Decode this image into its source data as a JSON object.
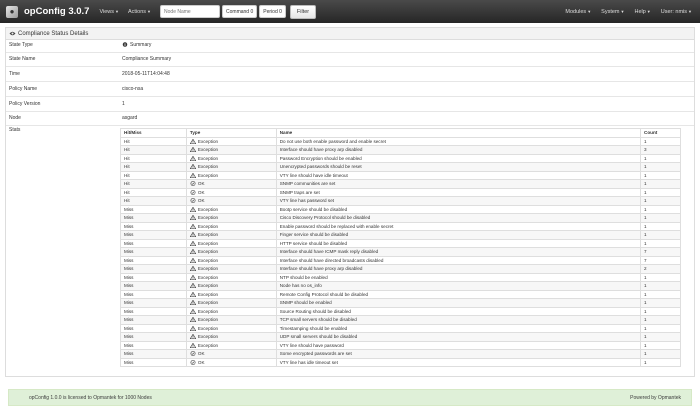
{
  "nav": {
    "brand": "opConfig 3.0.7",
    "menus_left": [
      "Views",
      "Actions"
    ],
    "node_placeholder": "Node Name",
    "command_label": "Command",
    "command_badge": "0",
    "period_label": "Period",
    "period_badge": "0",
    "filter_label": "Filter",
    "menus_right": [
      "Modules",
      "System",
      "Help",
      "User: nmis"
    ]
  },
  "panel": {
    "title": "Compliance Status Details",
    "fields": [
      {
        "key": "State Type",
        "value": "Summary"
      },
      {
        "key": "State Name",
        "value": "Compliance Summary"
      },
      {
        "key": "Time",
        "value": "2018-05-11T14:04:48"
      },
      {
        "key": "Policy Name",
        "value": "cisco-nsa"
      },
      {
        "key": "Policy Version",
        "value": "1"
      },
      {
        "key": "Node",
        "value": "asgard"
      },
      {
        "key": "Stats",
        "value": ""
      }
    ]
  },
  "stats": {
    "headers": [
      "Hit/Miss",
      "Type",
      "Name",
      "Count"
    ],
    "rows": [
      {
        "hit": "Hit",
        "type": "Exception",
        "name": "Do not use both enable password and enable secret",
        "count": "1"
      },
      {
        "hit": "Hit",
        "type": "Exception",
        "name": "Interface should have proxy arp disabled",
        "count": "3"
      },
      {
        "hit": "Hit",
        "type": "Exception",
        "name": "Password Encryption should be enabled",
        "count": "1"
      },
      {
        "hit": "Hit",
        "type": "Exception",
        "name": "Unencrypted passwords should be reset",
        "count": "1"
      },
      {
        "hit": "Hit",
        "type": "Exception",
        "name": "VTY line should have idle timeout",
        "count": "1"
      },
      {
        "hit": "Hit",
        "type": "OK",
        "name": "SNMP communities are set",
        "count": "1"
      },
      {
        "hit": "Hit",
        "type": "OK",
        "name": "SNMP traps are set",
        "count": "1"
      },
      {
        "hit": "Hit",
        "type": "OK",
        "name": "VTY line has password set",
        "count": "1"
      },
      {
        "hit": "Miss",
        "type": "Exception",
        "name": "Bootp service should be disabled",
        "count": "1"
      },
      {
        "hit": "Miss",
        "type": "Exception",
        "name": "Cisco Discovery Protocol should be disabled",
        "count": "1"
      },
      {
        "hit": "Miss",
        "type": "Exception",
        "name": "Enable password should be replaced with enable secret",
        "count": "1"
      },
      {
        "hit": "Miss",
        "type": "Exception",
        "name": "Finger service should be disabled",
        "count": "1"
      },
      {
        "hit": "Miss",
        "type": "Exception",
        "name": "HTTP service should be disabled",
        "count": "1"
      },
      {
        "hit": "Miss",
        "type": "Exception",
        "name": "Interface should have ICMP mask reply disabled",
        "count": "7"
      },
      {
        "hit": "Miss",
        "type": "Exception",
        "name": "Interface should have directed broadcasts disabled",
        "count": "7"
      },
      {
        "hit": "Miss",
        "type": "Exception",
        "name": "Interface should have proxy arp disabled",
        "count": "2"
      },
      {
        "hit": "Miss",
        "type": "Exception",
        "name": "NTP should be enabled",
        "count": "1"
      },
      {
        "hit": "Miss",
        "type": "Exception",
        "name": "Node has no os_info",
        "count": "1"
      },
      {
        "hit": "Miss",
        "type": "Exception",
        "name": "Remote Config Protocol should be disabled",
        "count": "1"
      },
      {
        "hit": "Miss",
        "type": "Exception",
        "name": "SNMP should be enabled",
        "count": "1"
      },
      {
        "hit": "Miss",
        "type": "Exception",
        "name": "Source Routing should be disabled",
        "count": "1"
      },
      {
        "hit": "Miss",
        "type": "Exception",
        "name": "TCP small servers should be disabled",
        "count": "1"
      },
      {
        "hit": "Miss",
        "type": "Exception",
        "name": "Timestamping should be enabled",
        "count": "1"
      },
      {
        "hit": "Miss",
        "type": "Exception",
        "name": "UDP small servers should be disabled",
        "count": "1"
      },
      {
        "hit": "Miss",
        "type": "Exception",
        "name": "VTY line should have password",
        "count": "1"
      },
      {
        "hit": "Miss",
        "type": "OK",
        "name": "Some encrypted passwords are set",
        "count": "1"
      },
      {
        "hit": "Miss",
        "type": "OK",
        "name": "VTY line has idle timeout set",
        "count": "1"
      }
    ]
  },
  "footer": {
    "license": "opConfig 1.0.0 is licensed to Opmantek for 1000 Nodes",
    "powered": "Powered by Opmantek"
  }
}
